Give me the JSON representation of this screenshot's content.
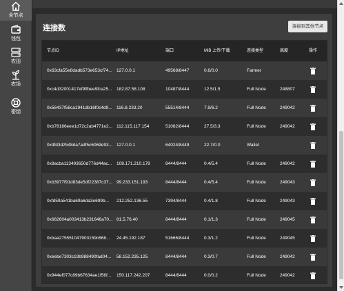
{
  "sidebar": {
    "items": [
      {
        "label": "全节点",
        "icon": "home-icon",
        "active": true
      },
      {
        "label": "钱包",
        "icon": "wallet-icon",
        "active": false
      },
      {
        "label": "农田",
        "icon": "storage-icon",
        "active": false
      },
      {
        "label": "农场",
        "icon": "farm-icon",
        "active": false
      },
      {
        "label": "密钥",
        "icon": "key-icon",
        "active": false
      }
    ]
  },
  "main": {
    "title": "连接数",
    "connect_button": "连接到其他节点",
    "table": {
      "headers": [
        "节点ID",
        "IP地址",
        "端口",
        "MiB 上传/下载",
        "连接类型",
        "高度",
        "操作"
      ],
      "rows": [
        {
          "id": "0x63cfa55e8dadb573e653cf74...",
          "ip": "127.0.0.1",
          "port": "49568/8447",
          "mib": "0.6/0.0",
          "type": "Farmer",
          "height": ""
        },
        {
          "id": "0xc4d32001417ef9ffbee9fca25...",
          "ip": "182.87.58.108",
          "port": "10487/8444",
          "mib": "12.5/1.5",
          "type": "Full Node",
          "height": "248807"
        },
        {
          "id": "0x56437f58ca1941db16f0c4d9...",
          "ip": "116.8.233.20",
          "port": "55514/8444",
          "mib": "7.9/6.2",
          "type": "Full Node",
          "height": "249042"
        },
        {
          "id": "0xb78186eee1d72c2ab4771e2...",
          "ip": "112.115.117.154",
          "port": "51082/8444",
          "mib": "27.5/3.3",
          "type": "Full Node",
          "height": "249042"
        },
        {
          "id": "0x4fd3d2548da7adf5c6069e93...",
          "ip": "127.0.0.1",
          "port": "64024/8449",
          "mib": "22.7/0.0",
          "type": "Wallet",
          "height": ""
        },
        {
          "id": "0x8acba113493650d776d44ac...",
          "ip": "108.171.210.178",
          "port": "8444/8444",
          "mib": "0.4/5.4",
          "type": "Full Node",
          "height": "249042"
        },
        {
          "id": "0xb3977f91d83de5df22387c37...",
          "ip": "99.233.151.193",
          "port": "8444/8444",
          "mib": "0.4/5.4",
          "type": "Full Node",
          "height": "249043"
        },
        {
          "id": "0xfd59a541ba69a6da3e699b...",
          "ip": "212.252.136.55",
          "port": "7394/8444",
          "mib": "0.4/1.8",
          "type": "Full Node",
          "height": "249043"
        },
        {
          "id": "0x662604a003413b231646a70...",
          "ip": "81.5.76.40",
          "port": "8444/8444",
          "mib": "0.1/1.3",
          "type": "Full Node",
          "height": "249045"
        },
        {
          "id": "0xbaa275551047903159c668...",
          "ip": "24.45.192.187",
          "port": "51666/8444",
          "mib": "0.3/1.2",
          "type": "Full Node",
          "height": "249045"
        },
        {
          "id": "0xeebe7303c19b988490fad04...",
          "ip": "58.152.235.125",
          "port": "8444/8444",
          "mib": "0.3/0.7",
          "type": "Full Node",
          "height": "249042"
        },
        {
          "id": "0x944ef077c89b67634ae1f56f...",
          "ip": "150.117.242.207",
          "port": "8444/8444",
          "mib": "0.0/0.2",
          "type": "Full Node",
          "height": "249042"
        }
      ]
    }
  },
  "colors": {
    "background": "#2b2b2b",
    "sidebar": "#454545",
    "card": "#3e3e3e",
    "table_header": "#252525",
    "row_odd": "#3a3a3a",
    "row_even": "#2d2d2d",
    "button": "#e8e8e8"
  }
}
